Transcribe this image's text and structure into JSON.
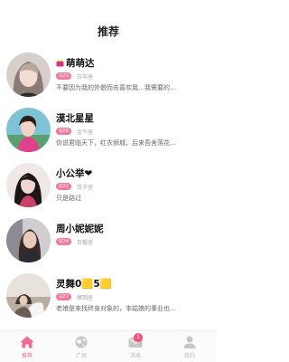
{
  "header": {
    "title": "推荐"
  },
  "users": [
    {
      "name": "萌萌达",
      "age": "♀25",
      "zodiac": "白羊座",
      "bio": "不要因为我的外貌而去喜欢我…我需要的…"
    },
    {
      "name": "漠北星星",
      "age": "♀26",
      "zodiac": "金牛座",
      "bio": "你说君临天下，红衣倾城，后来吾舍落花…"
    },
    {
      "name": "小公举❤",
      "age": "♀22",
      "zodiac": "双子座",
      "bio": "只是路过"
    },
    {
      "name": "周小妮妮妮",
      "age": "♀24",
      "zodiac": "巨蟹座",
      "bio": ""
    },
    {
      "name": "灵舞0🟨5🟨",
      "age": "♀27",
      "zodiac": "摩羯座",
      "bio": "老娘是来找终身对象的，本姑娘的事业也…"
    }
  ],
  "tabbar": {
    "home": "推荐",
    "square": "广场",
    "messages": "消息",
    "messages_badge": "1",
    "mine": "我的"
  },
  "colors": {
    "accent": "#f06b8f",
    "badge": "#f27a9c",
    "inactive": "#b9b9b9"
  }
}
